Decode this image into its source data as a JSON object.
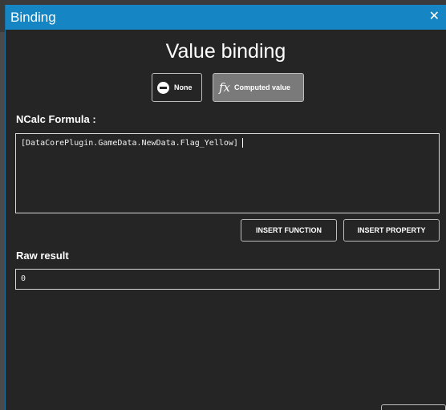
{
  "window": {
    "title": "Binding",
    "close_glyph": "✕"
  },
  "heading": "Value binding",
  "mode_buttons": {
    "none_label": "None",
    "none_icon": "no-entry-icon",
    "computed_label": "Computed value",
    "computed_icon_glyph": "fx",
    "selected": "computed"
  },
  "formula": {
    "label": "NCalc Formula :",
    "value": "[DataCorePlugin.GameData.NewData.Flag_Yellow]"
  },
  "actions": {
    "insert_function": "INSERT FUNCTION",
    "insert_property": "INSERT PROPERTY"
  },
  "raw_result": {
    "label": "Raw result",
    "value": "0"
  },
  "colors": {
    "titlebar": "#1685c4",
    "background": "#252526",
    "selected_button": "#7a7a7a"
  }
}
